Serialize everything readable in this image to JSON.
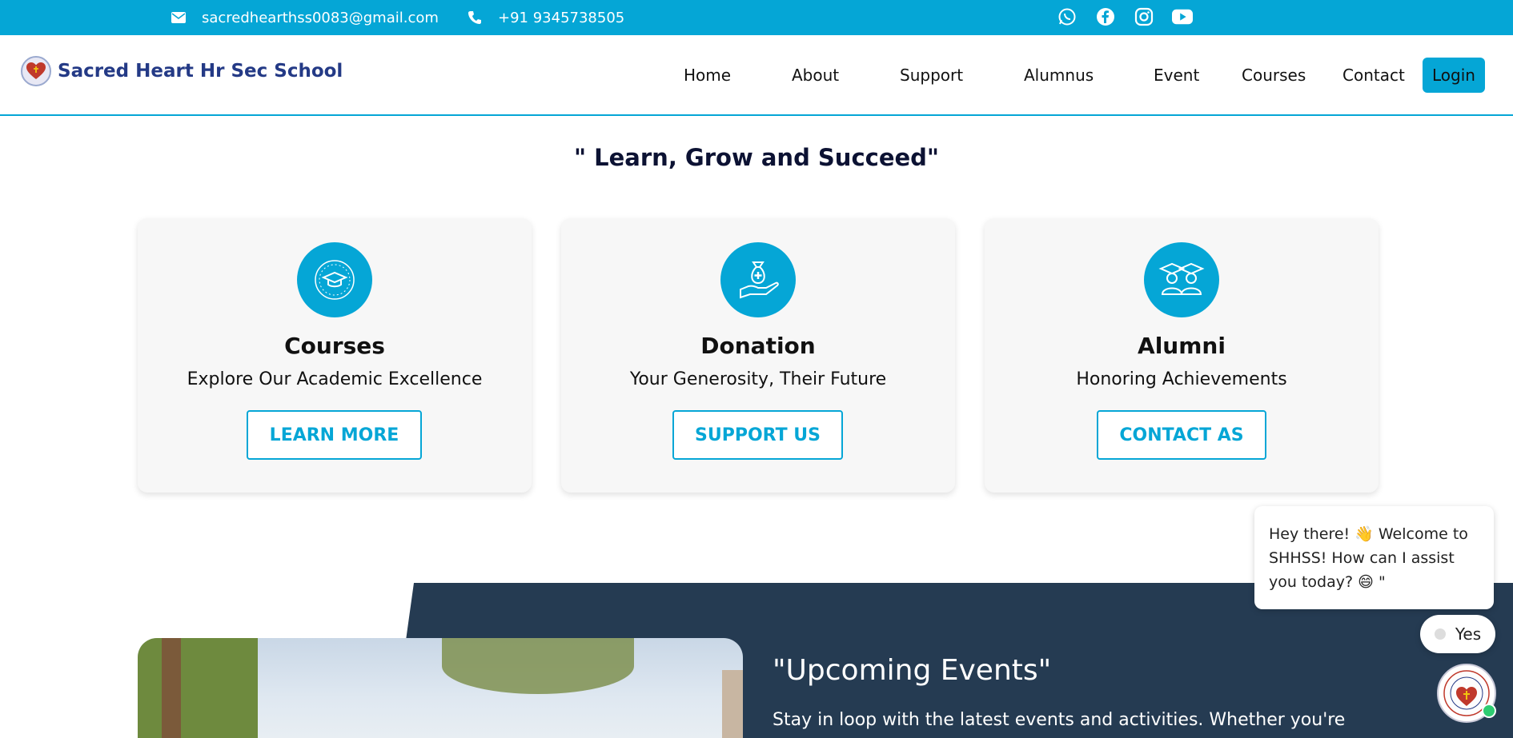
{
  "topbar": {
    "email": "sacredhearthss0083@gmail.com",
    "phone": "+91 9345738505",
    "socials": [
      "whatsapp-icon",
      "facebook-icon",
      "instagram-icon",
      "youtube-icon"
    ],
    "color": "#05a6d6"
  },
  "header": {
    "school_name": "Sacred Heart Hr Sec School",
    "nav": [
      "Home",
      "About",
      "Support",
      "Alumnus",
      "Event",
      "Courses",
      "Contact"
    ],
    "login_label": "Login"
  },
  "tagline": "\" Learn, Grow and Succeed\"",
  "cards": [
    {
      "title": "Courses",
      "subtitle": "Explore Our Academic Excellence",
      "button": "LEARN MORE",
      "icon": "graduation-cap-icon"
    },
    {
      "title": "Donation",
      "subtitle": "Your Generosity, Their Future",
      "button": "SUPPORT US",
      "icon": "donation-bag-icon"
    },
    {
      "title": "Alumni",
      "subtitle": "Honoring Achievements",
      "button": "CONTACT AS",
      "icon": "graduates-icon"
    }
  ],
  "events": {
    "title": "\"Upcoming Events\"",
    "text": "Stay in loop with the latest events and activities. Whether you're"
  },
  "chat": {
    "message": "Hey there! 👋 Welcome to SHHSS! How can I assist you today? 😄 \"",
    "reply": "Yes"
  }
}
